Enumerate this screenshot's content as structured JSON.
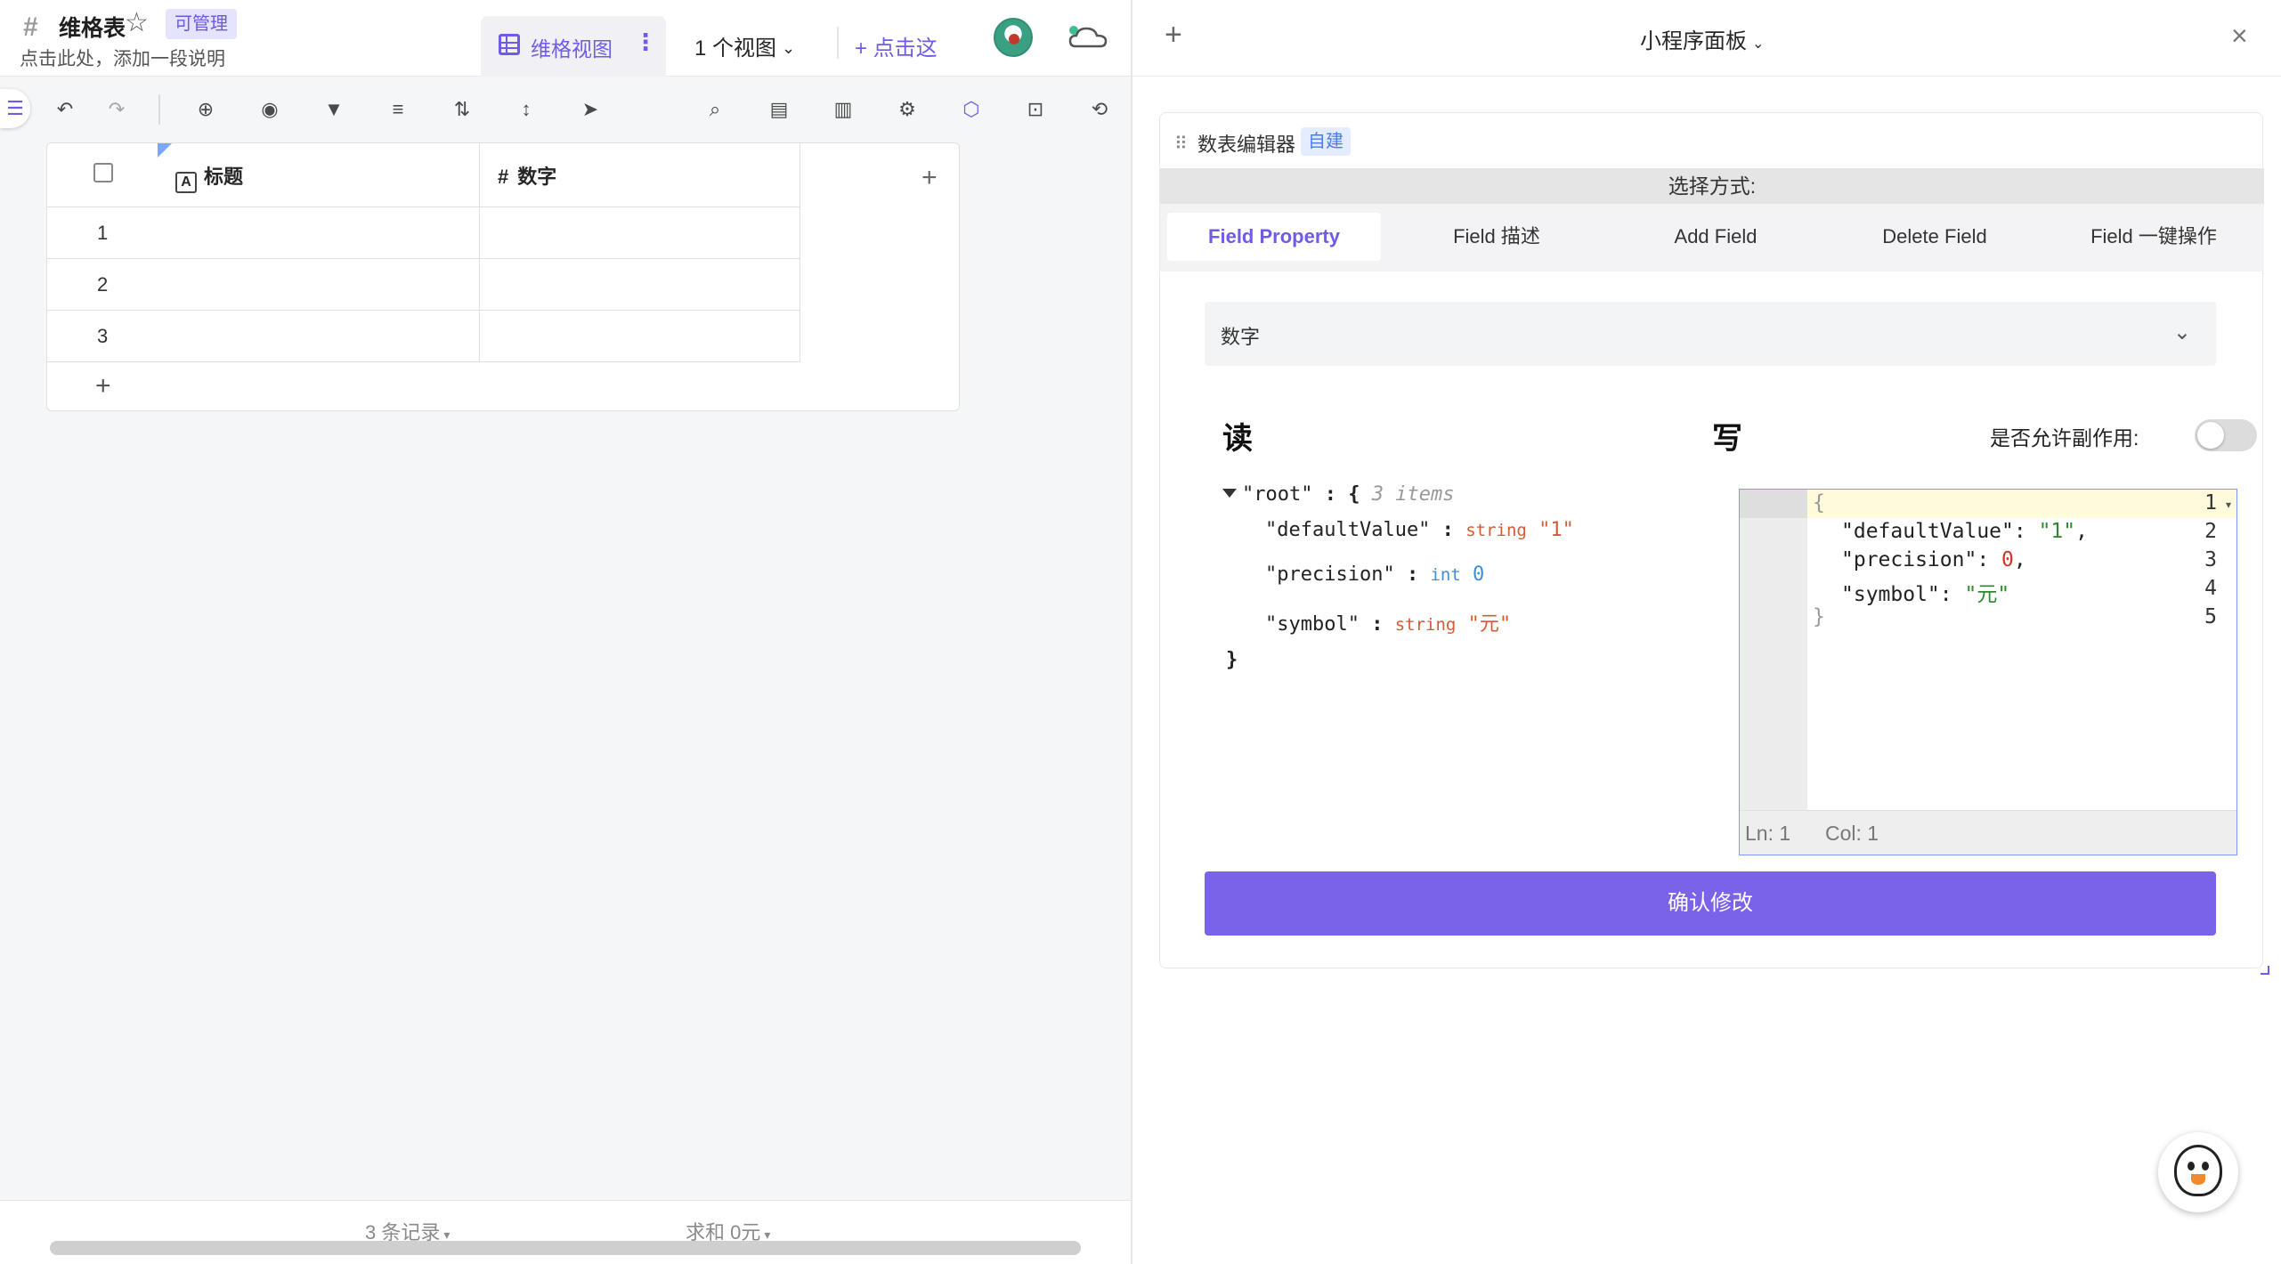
{
  "table": {
    "title": "维格表",
    "permission_badge": "可管理",
    "description": "点击此处，添加一段说明",
    "view_tab": "维格视图",
    "view_count": "1 个视图",
    "add_view": "点击这"
  },
  "grid": {
    "columns": [
      "标题",
      "数字"
    ],
    "title_icon": "A",
    "number_icon": "#",
    "rows": [
      "1",
      "2",
      "3"
    ]
  },
  "footer": {
    "records": "3 条记录",
    "sum": "求和 0元"
  },
  "panel": {
    "title": "小程序面板",
    "widget_name": "数表编辑器",
    "widget_badge": "自建",
    "select_label": "选择方式:",
    "tabs": [
      "Field Property",
      "Field 描述",
      "Add Field",
      "Delete Field",
      "Field 一键操作"
    ],
    "active_tab": "Field Property",
    "field_select_value": "数字",
    "read_heading": "读",
    "write_heading": "写",
    "side_effect_label": "是否允许副作用:",
    "side_effect_enabled": false,
    "confirm_button": "确认修改"
  },
  "json_view": {
    "root_key": "\"root\"",
    "root_open": ": {",
    "root_meta": "3 items",
    "close": "}",
    "items": [
      {
        "key": "\"defaultValue\"",
        "sep": " : ",
        "type": "string",
        "value": "\"1\""
      },
      {
        "key": "\"precision\"",
        "sep": " : ",
        "type": "int",
        "value": "0"
      },
      {
        "key": "\"symbol\"",
        "sep": " : ",
        "type": "string",
        "value": "\"元\""
      }
    ]
  },
  "editor": {
    "line_numbers": [
      "1",
      "2",
      "3",
      "4",
      "5"
    ],
    "lines": {
      "l1": "{",
      "l2_key": "\"defaultValue\"",
      "l2_val": "\"1\"",
      "l3_key": "\"precision\"",
      "l3_val": "0",
      "l4_key": "\"symbol\"",
      "l4_val": "\"元\"",
      "l5": "}"
    },
    "status_ln": "Ln: 1",
    "status_col": "Col: 1"
  },
  "colors": {
    "accent": "#6e5ce6",
    "button": "#7a63e8",
    "badge_bg": "#e4e4ff"
  }
}
